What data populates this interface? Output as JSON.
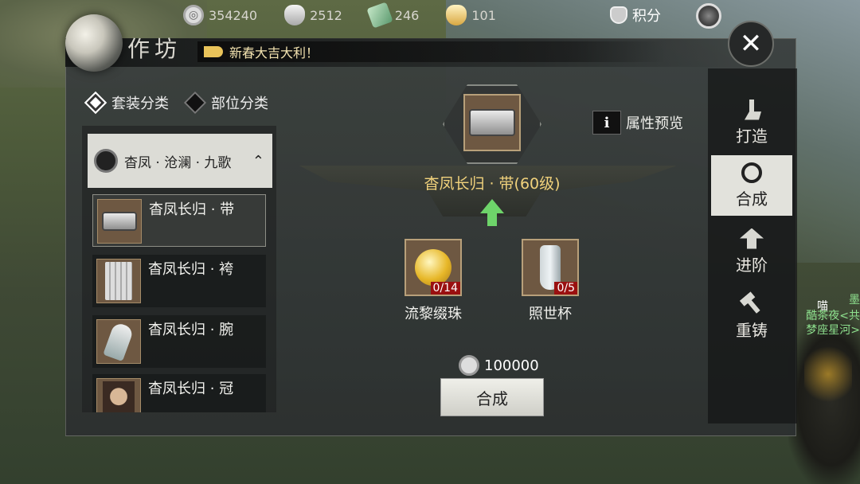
{
  "currencies": [
    {
      "icon": "coin-icon",
      "value": "354240"
    },
    {
      "icon": "silver-ingot-icon",
      "value": "2512"
    },
    {
      "icon": "jade-icon",
      "value": "246"
    },
    {
      "icon": "gold-ingot-icon",
      "value": "101"
    }
  ],
  "score_label": "积分",
  "window": {
    "title": "作坊",
    "banner": "新春大吉大利！"
  },
  "categories": {
    "set": "套装分类",
    "slot": "部位分类"
  },
  "set_group": {
    "label": "杳凤 · 沧澜 · 九歌"
  },
  "items": [
    {
      "name": "杳凤长归 · 带",
      "icon": "belt-icon",
      "selected": true
    },
    {
      "name": "杳凤长归 · 袴",
      "icon": "pants-icon",
      "selected": false
    },
    {
      "name": "杳凤长归 · 腕",
      "icon": "gauntlet-icon",
      "selected": false
    },
    {
      "name": "杳凤长归 · 冠",
      "icon": "crown-icon",
      "selected": false
    }
  ],
  "target": {
    "name": "杳凤长归 · 带(60级)"
  },
  "attr_preview": "属性预览",
  "materials": [
    {
      "name": "流黎缀珠",
      "count": "0/14",
      "icon": "pearl-icon"
    },
    {
      "name": "照世杯",
      "count": "0/5",
      "icon": "vase-icon"
    }
  ],
  "cost": "100000",
  "craft_button": "合成",
  "tabs": [
    {
      "label": "打造",
      "icon": "anvil-icon",
      "active": false
    },
    {
      "label": "合成",
      "icon": "combine-icon",
      "active": true
    },
    {
      "label": "进阶",
      "icon": "advance-icon",
      "active": false
    },
    {
      "label": "重铸",
      "icon": "hammer-icon",
      "active": false
    }
  ],
  "npc_text": {
    "line1": "墨",
    "line2": "喵",
    "line3": "酷茶夜<共",
    "line4": "梦座星河>"
  },
  "colors": {
    "accent_gold": "#f1d27c",
    "count_red": "#9a1010",
    "arrow_green": "#6ed46a"
  }
}
